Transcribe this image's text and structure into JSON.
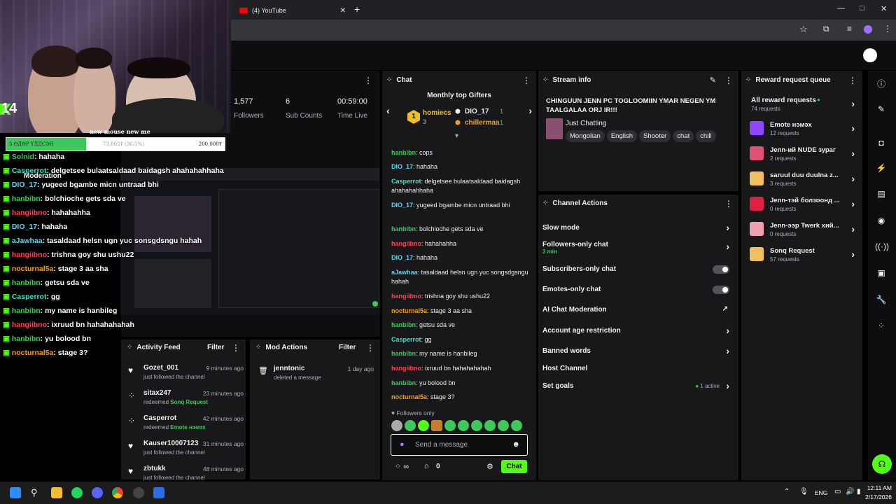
{
  "browser": {
    "tab_title": "(4) YouTube",
    "new_tab": "+",
    "window_controls": [
      "—",
      "□",
      "✕"
    ]
  },
  "webcam": {
    "viewer_count": "14"
  },
  "goal": {
    "title": "new mouse new me",
    "current": "73,002₮ (36.5%)",
    "left_label": "5 ӨДӨР ҮЛДСЭН",
    "right_label": "200,000₮",
    "progress": 0.365
  },
  "overlay_chat": [
    {
      "user": "Solnid",
      "text": ": hahaha",
      "color": "#3ec75a"
    },
    {
      "user": "Casperrot",
      "text": ": delgetsee bulaatsaldaad baidagsh ahahahahhaha",
      "color": "#39e0c8"
    },
    {
      "user": "DIO_17",
      "text": ": yugeed bgambe micn untraad bhi",
      "color": "#5fd3f0"
    },
    {
      "user": "hanbibn",
      "text": ": bolchioche gets sda ve",
      "color": "#3ec75a"
    },
    {
      "user": "hangiibno",
      "text": ": hahahahha",
      "color": "#ff4050"
    },
    {
      "user": "DIO_17",
      "text": ": hahaha",
      "color": "#5fd3f0"
    },
    {
      "user": "aJawhaa",
      "text": ": tasaldaad helsn ugn yuc sonsgdsngu hahah",
      "color": "#5fd3f0"
    },
    {
      "user": "hangiibno",
      "text": ": trishna goy shu ushu22",
      "color": "#ff4050"
    },
    {
      "user": "nocturnal5a",
      "text": ": stage 3 aa sha",
      "color": "#f0a020"
    },
    {
      "user": "hanbibn",
      "text": ": getsu sda ve",
      "color": "#3ec75a"
    },
    {
      "user": "Casperrot",
      "text": ": gg",
      "color": "#39e0c8"
    },
    {
      "user": "hanbibn",
      "text": ": my name is hanbileg",
      "color": "#3ec75a"
    },
    {
      "user": "hangiibno",
      "text": ": ixruud bn hahahahahah",
      "color": "#ff4050"
    },
    {
      "user": "hanbibn",
      "text": ": yu bolood bn",
      "color": "#3ec75a"
    },
    {
      "user": "nocturnal5a",
      "text": ": stage 3?",
      "color": "#f0a020"
    }
  ],
  "overlay_labels": {
    "moderation": "Moderation"
  },
  "stats": {
    "followers_value": "1,577",
    "followers_label": "Followers",
    "subs_value": "6",
    "subs_label": "Sub Counts",
    "time_value": "00:59:00",
    "time_label": "Time Live"
  },
  "chat": {
    "title": "Chat",
    "gifters_title": "Monthly top Gifters",
    "gifters": [
      {
        "rank": "1",
        "name": "homiecs",
        "count": "3"
      },
      {
        "name": "DIO_17",
        "count": "1"
      },
      {
        "name": "chillermaa",
        "count": "1"
      }
    ],
    "messages": [
      {
        "user": "hanbibn",
        "text": ": cops",
        "color": "#3ec75a"
      },
      {
        "user": "DIO_17",
        "text": ": hahaha",
        "color": "#5fd3f0"
      },
      {
        "user": "Casperrot",
        "text": ": delgetsee bulaatsaldaad baidagsh ahahahahhaha",
        "color": "#39e0c8"
      },
      {
        "user": "DIO_17",
        "text": ": yugeed bgambe micn untraad bhi",
        "color": "#5fd3f0"
      },
      {
        "user": "hanbibn",
        "text": ": bolchioche gets sda ve",
        "color": "#3ec75a"
      },
      {
        "user": "hangiibno",
        "text": ": hahahahha",
        "color": "#ff4050"
      },
      {
        "user": "DIO_17",
        "text": ": hahaha",
        "color": "#5fd3f0"
      },
      {
        "user": "aJawhaa",
        "text": ": tasaldaad helsn ugn yuc songsdgsngu hahah",
        "color": "#5fd3f0"
      },
      {
        "user": "hangiibno",
        "text": ": trishna goy shu ushu22",
        "color": "#ff4050"
      },
      {
        "user": "nocturnal5a",
        "text": ": stage 3 aa sha",
        "color": "#f0a020"
      },
      {
        "user": "hanbibn",
        "text": ": getsu sda ve",
        "color": "#3ec75a"
      },
      {
        "user": "Casperrot",
        "text": ": gg",
        "color": "#39e0c8"
      },
      {
        "user": "hanbibn",
        "text": ": my name is hanbileg",
        "color": "#3ec75a"
      },
      {
        "user": "hangiibno",
        "text": ": ixruud bn hahahahahah",
        "color": "#ff4050"
      },
      {
        "user": "hanbibn",
        "text": ": yu bolood bn",
        "color": "#3ec75a"
      },
      {
        "user": "nocturnal5a",
        "text": ": stage 3?",
        "color": "#f0a020"
      }
    ],
    "followers_only": "Followers only",
    "input_placeholder": "Send a message",
    "points": "0",
    "send_label": "Chat"
  },
  "stream_info": {
    "title": "Stream info",
    "stream_title": "CHINGUUN JENN PC TOGLOOMIIN YMAR NEGEN YM TAALGALAA ORJ IR!!!",
    "category": "Just Chatting",
    "tags": [
      "Mongolian",
      "English",
      "Shooter",
      "chat",
      "chill"
    ]
  },
  "channel_actions": {
    "title": "Channel Actions",
    "items": [
      {
        "label": "Slow mode"
      },
      {
        "label": "Followers-only chat",
        "sub": "3 min"
      },
      {
        "label": "Subscribers-only chat"
      },
      {
        "label": "Emotes-only chat"
      },
      {
        "label": "AI Chat Moderation"
      },
      {
        "label": "Account age restriction"
      },
      {
        "label": "Banned words"
      },
      {
        "label": "Host Channel"
      },
      {
        "label": "Set goals",
        "sub": "1 active"
      }
    ]
  },
  "rewards": {
    "title": "Reward request queue",
    "all_label": "All reward requests",
    "all_count": "74 requests",
    "items": [
      {
        "name": "Emote нэмэх",
        "count": "12 requests",
        "color": "#9146ff"
      },
      {
        "name": "Jenn-ий NUDE зураг",
        "count": "2 requests",
        "color": "#e05070"
      },
      {
        "name": "saruul duu duulna z...",
        "count": "3 requests",
        "color": "#f0c060"
      },
      {
        "name": "Jenn-тэй болзоонд ...",
        "count": "0 requests",
        "color": "#e02040"
      },
      {
        "name": "Jenn-ээр Twerk хий...",
        "count": "0 requests",
        "color": "#f0a0b0"
      },
      {
        "name": "Sonq Request",
        "count": "57 requests",
        "color": "#f0c060"
      }
    ]
  },
  "activity": {
    "title": "Activity Feed",
    "filter": "Filter",
    "items": [
      {
        "name": "Gozet_001",
        "time": "9 minutes ago",
        "desc": "just followed the channel",
        "icon": "heart"
      },
      {
        "name": "sitax247",
        "time": "23 minutes ago",
        "desc": "redeemed",
        "reward": "Sonq Request",
        "icon": "points"
      },
      {
        "name": "Casperrot",
        "time": "42 minutes ago",
        "desc": "redeemed",
        "reward": "Emote нэмэх",
        "icon": "points"
      },
      {
        "name": "Kauser10007123",
        "time": "31 minutes ago",
        "desc": "just followed the channel",
        "icon": "heart"
      },
      {
        "name": "zbtukk",
        "time": "48 minutes ago",
        "desc": "just followed the channel",
        "icon": "heart"
      }
    ]
  },
  "mod_actions": {
    "title": "Mod Actions",
    "filter": "Filter",
    "items": [
      {
        "name": "jenntonic",
        "time": "1 day ago",
        "desc": "deleted a message"
      }
    ]
  },
  "taskbar": {
    "lang": "ENG",
    "time": "12:11 AM",
    "date": "2/17/2026"
  },
  "colors": {
    "accent": "#53fc18",
    "panel": "#18181b",
    "bg": "#0e0e10"
  }
}
